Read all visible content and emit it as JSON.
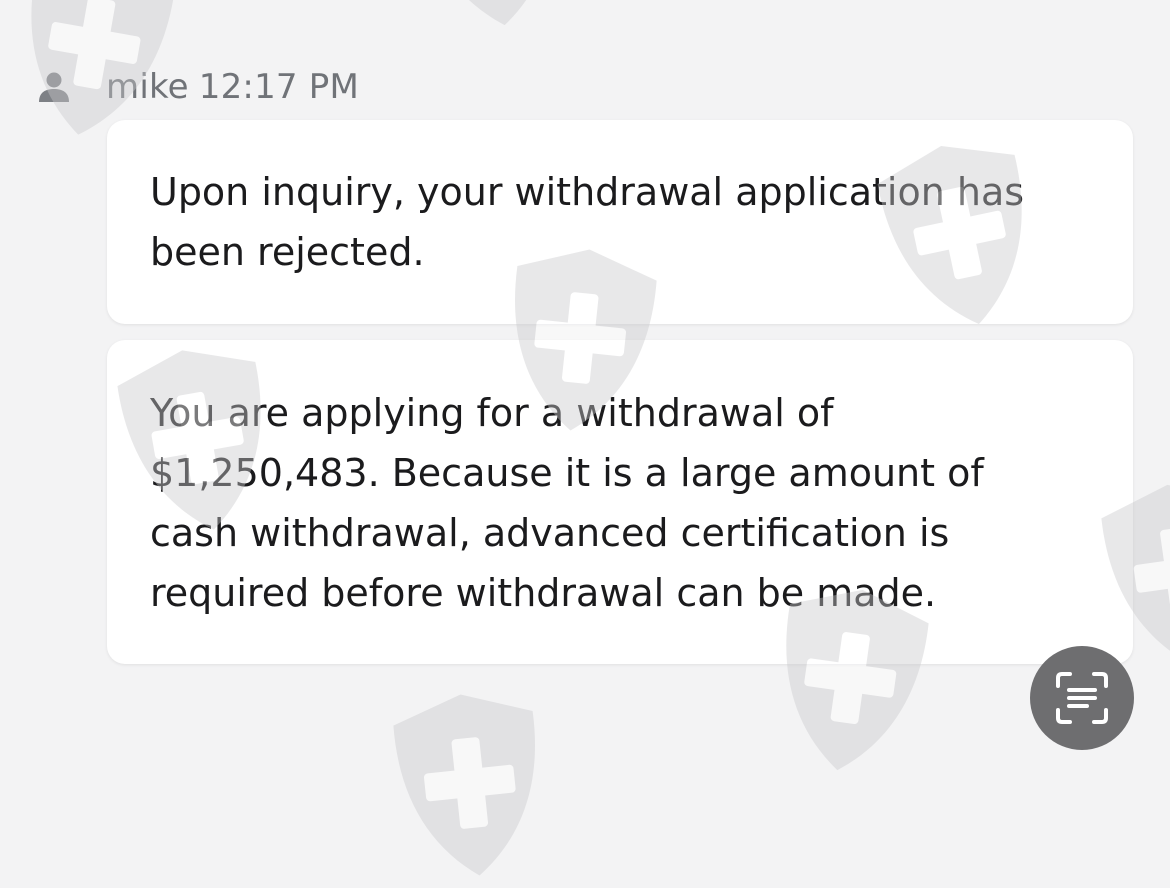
{
  "message": {
    "sender": "mike",
    "time": "12:17 PM",
    "bubbles": [
      "Upon inquiry, your withdrawal application has been rejected.",
      "You are applying for a withdrawal of $1,250,483. Because it is a large amount of cash withdrawal, advanced certification is required before withdrawal can be made."
    ]
  },
  "icons": {
    "avatar": "person-icon",
    "scan": "scan-text-icon",
    "watermark": "shield-cross-icon"
  },
  "colors": {
    "background": "#f3f3f4",
    "bubble": "#ffffff",
    "text": "#1b1b1d",
    "meta_text": "#707378",
    "scan_button": "#6e6e70",
    "watermark": "#c9c9cc"
  }
}
